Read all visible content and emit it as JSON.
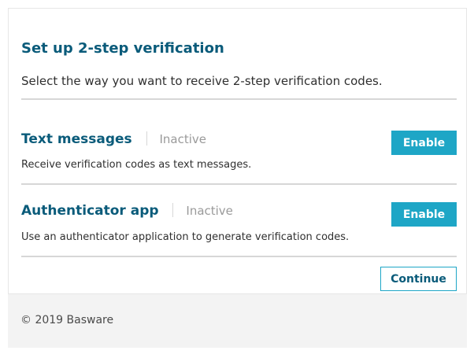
{
  "page": {
    "title": "Set up 2-step verification",
    "subtitle": "Select the way you want to receive 2-step verification codes."
  },
  "options": [
    {
      "title": "Text messages",
      "status": "Inactive",
      "description": "Receive verification codes as text messages.",
      "button_label": "Enable"
    },
    {
      "title": "Authenticator app",
      "status": "Inactive",
      "description": "Use an authenticator application to generate verification codes.",
      "button_label": "Enable"
    }
  ],
  "actions": {
    "continue_label": "Continue"
  },
  "footer": {
    "text": "© 2019 Basware"
  },
  "colors": {
    "title": "#0a5b7a",
    "accent": "#1ea6c6",
    "status": "#9a9a9a",
    "divider": "#d7d7d7",
    "footer_bg": "#f3f3f3"
  }
}
